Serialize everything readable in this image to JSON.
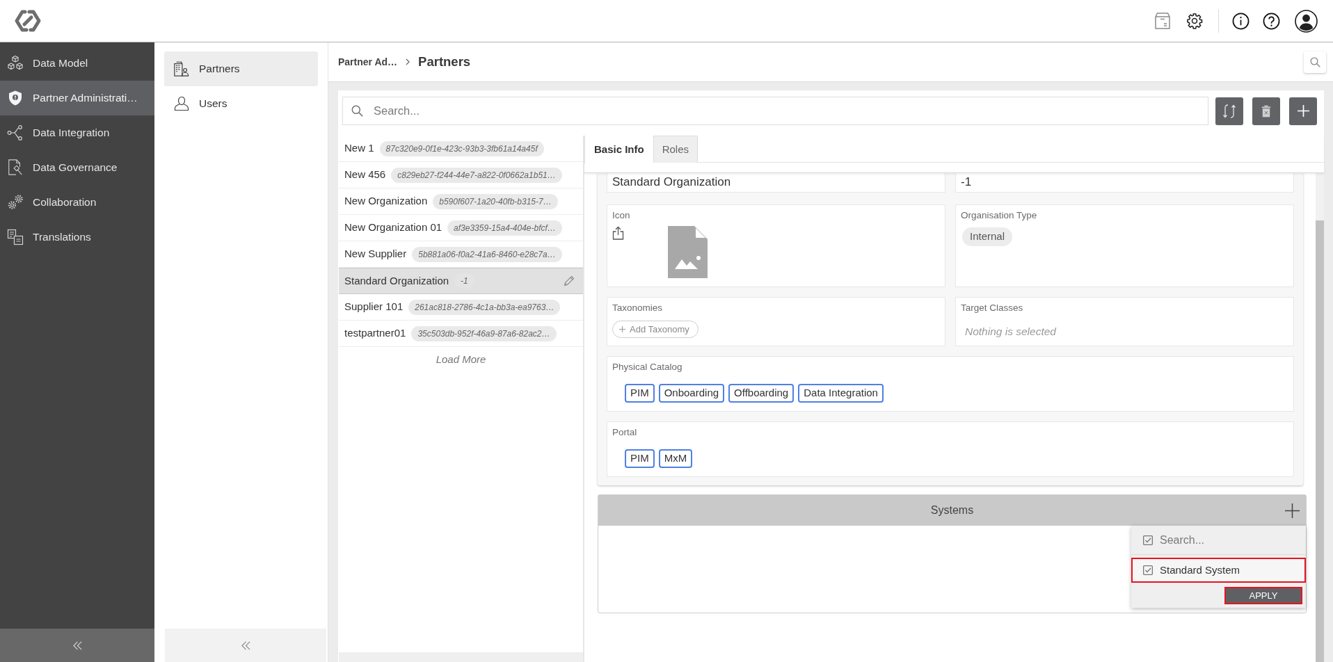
{
  "nav": {
    "items": [
      {
        "label": "Data Model",
        "selected": false
      },
      {
        "label": "Partner Administrati…",
        "selected": true
      },
      {
        "label": "Data Integration",
        "selected": false
      },
      {
        "label": "Data Governance",
        "selected": false
      },
      {
        "label": "Collaboration",
        "selected": false
      },
      {
        "label": "Translations",
        "selected": false
      }
    ]
  },
  "subnav": {
    "items": [
      {
        "label": "Partners",
        "selected": true
      },
      {
        "label": "Users",
        "selected": false
      }
    ]
  },
  "breadcrumb": [
    {
      "label": "Partner Ad…",
      "current": false
    },
    {
      "label": "Partners",
      "current": true
    }
  ],
  "search": {
    "placeholder": "Search..."
  },
  "partners": {
    "items": [
      {
        "name": "New 1",
        "id": "87c320e9-0f1e-423c-93b3-3fb61a14a45f",
        "selected": false
      },
      {
        "name": "New 456",
        "id": "c829eb27-f244-44e7-a822-0f0662a1b51…",
        "selected": false
      },
      {
        "name": "New Organization",
        "id": "b590f607-1a20-40fb-b315-7…",
        "selected": false
      },
      {
        "name": "New Organization 01",
        "id": "af3e3359-15a4-404e-bfcf…",
        "selected": false
      },
      {
        "name": "New Supplier",
        "id": "5b881a06-f0a2-41a6-8460-e28c7a…",
        "selected": false
      },
      {
        "name": "Standard Organization",
        "id": "-1",
        "selected": true
      },
      {
        "name": "Supplier 101",
        "id": "261ac818-2786-4c1a-bb3a-ea9763…",
        "selected": false
      },
      {
        "name": "testpartner01",
        "id": "35c503db-952f-46a9-87a6-82ac2…",
        "selected": false
      }
    ],
    "load_more": "Load More"
  },
  "tabs": [
    {
      "label": "Basic Info",
      "selected": true
    },
    {
      "label": "Roles",
      "selected": false
    }
  ],
  "form": {
    "rows": [
      [
        {
          "kind": "text",
          "value": "Standard Organization"
        },
        {
          "kind": "text",
          "value": "-1"
        }
      ],
      [
        {
          "kind": "image",
          "label": "Icon"
        },
        {
          "kind": "chips",
          "label": "Organisation Type",
          "chips": [
            "Internal"
          ]
        }
      ],
      [
        {
          "kind": "add",
          "label": "Taxonomies",
          "button": "Add Taxonomy"
        },
        {
          "kind": "empty",
          "label": "Target Classes",
          "empty_text": "Nothing is selected"
        }
      ],
      [
        {
          "kind": "tags",
          "label": "Physical Catalog",
          "tags": [
            "PIM",
            "Onboarding",
            "Offboarding",
            "Data Integration"
          ]
        }
      ],
      [
        {
          "kind": "tags",
          "label": "Portal",
          "tags": [
            "PIM",
            "MxM"
          ]
        }
      ]
    ]
  },
  "systems": {
    "title": "Systems",
    "dropdown": {
      "placeholder": "Search...",
      "all_checked": true,
      "options": [
        {
          "label": "Standard System",
          "checked": true,
          "highlighted": true
        }
      ],
      "apply_button": {
        "label": "APPLY",
        "highlighted": true
      }
    }
  }
}
